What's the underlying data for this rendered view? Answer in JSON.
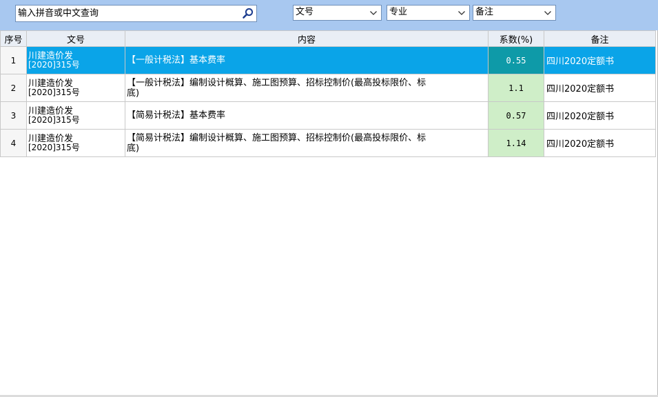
{
  "search": {
    "placeholder": "输入拼音或中文查询",
    "icon": "search-icon"
  },
  "filters": [
    {
      "value": "文号"
    },
    {
      "value": "专业"
    },
    {
      "value": "备注"
    }
  ],
  "table": {
    "columns": [
      "序号",
      "文号",
      "内容",
      "系数(%)",
      "备注"
    ],
    "rows": [
      {
        "seq": "1",
        "wh1": "川建造价发",
        "wh2": "[2020]315号",
        "content1": "【一般计税法】基本费率",
        "content2": "",
        "coef": "0.55",
        "note": "四川2020定额书",
        "selected": true
      },
      {
        "seq": "2",
        "wh1": "川建造价发",
        "wh2": "[2020]315号",
        "content1": "【一般计税法】编制设计概算、施工图预算、招标控制价(最高投标限价、标",
        "content2": "底)",
        "coef": "1.1",
        "note": "四川2020定额书",
        "selected": false
      },
      {
        "seq": "3",
        "wh1": "川建造价发",
        "wh2": "[2020]315号",
        "content1": "【简易计税法】基本费率",
        "content2": "",
        "coef": "0.57",
        "note": "四川2020定额书",
        "selected": false
      },
      {
        "seq": "4",
        "wh1": "川建造价发",
        "wh2": "[2020]315号",
        "content1": "【简易计税法】编制设计概算、施工图预算、招标控制价(最高投标限价、标",
        "content2": "底)",
        "coef": "1.14",
        "note": "四川2020定额书",
        "selected": false
      }
    ]
  },
  "colors": {
    "toolbar_bg": "#a8c8f0",
    "selected_row": "#0aa4e8",
    "coef_cell": "#cfeec8"
  }
}
